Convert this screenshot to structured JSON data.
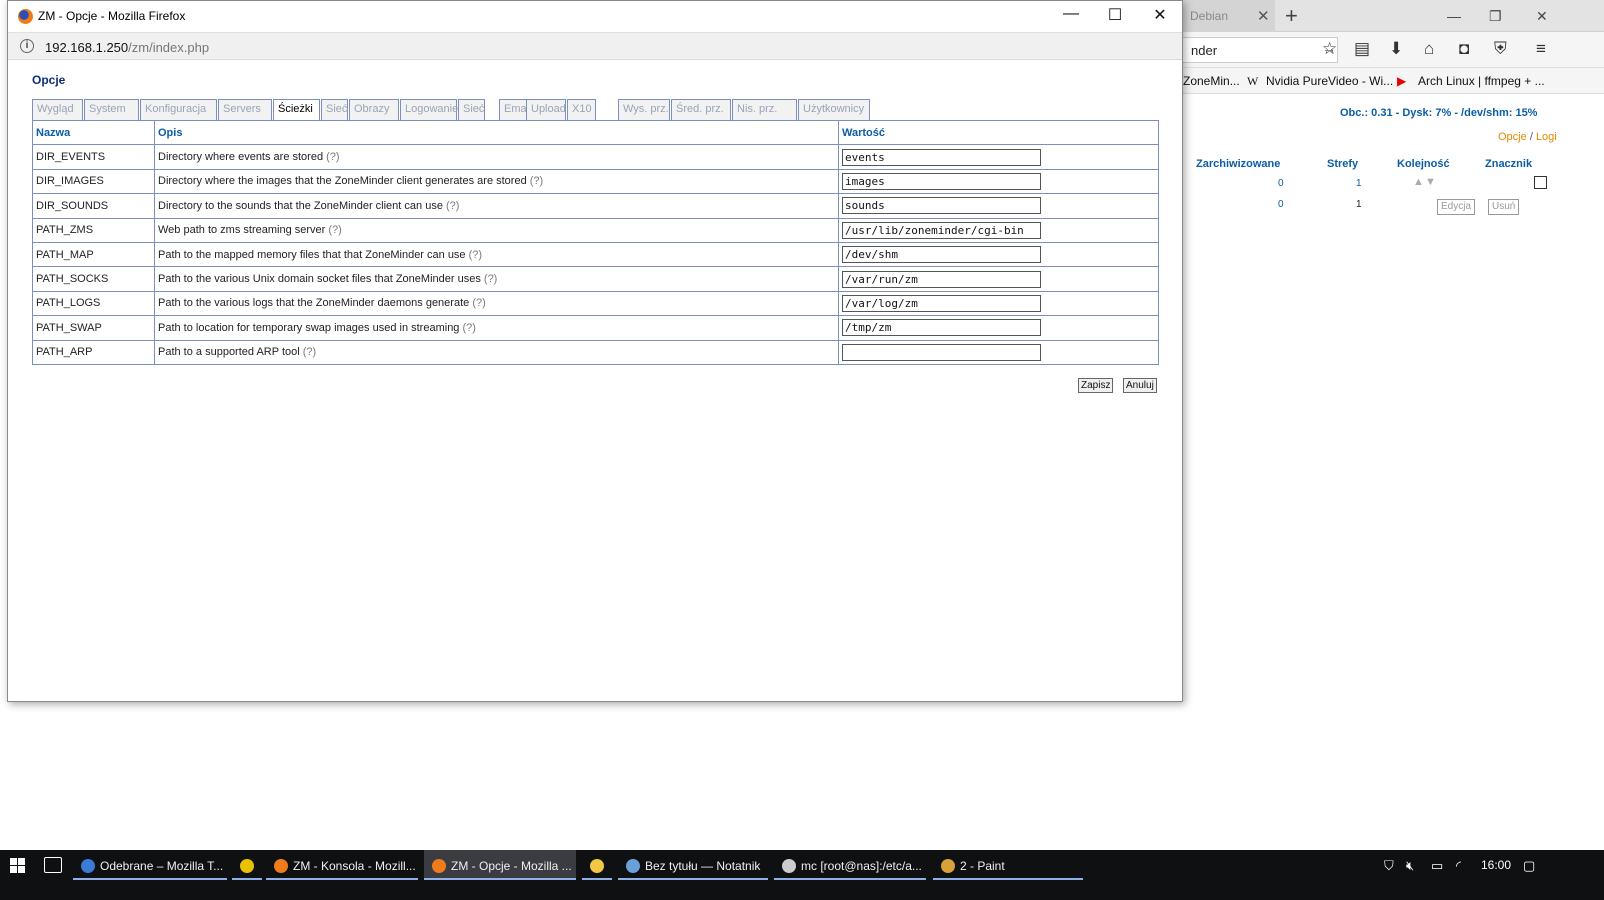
{
  "popup": {
    "title": "ZM - Opcje - Mozilla Firefox",
    "url_host": "192.168.1.250",
    "url_path": "/zm/index.php",
    "heading": "Opcje",
    "tabs": [
      {
        "label": "Wygląd",
        "active": false
      },
      {
        "label": "System",
        "active": false
      },
      {
        "label": "Konfiguracja",
        "active": false
      },
      {
        "label": "Servers",
        "active": false
      },
      {
        "label": "Ścieżki",
        "active": true
      },
      {
        "label": "Sieć",
        "active": false
      },
      {
        "label": "Obrazy",
        "active": false
      },
      {
        "label": "Logowanie",
        "active": false
      },
      {
        "label": "Sieć",
        "active": false
      },
      {
        "label": "Email",
        "active": false
      },
      {
        "label": "Upload",
        "active": false
      },
      {
        "label": "X10",
        "active": false
      },
      {
        "label": "Wys. prz.",
        "active": false
      },
      {
        "label": "Śred. prz.",
        "active": false
      },
      {
        "label": "Nis. prz.",
        "active": false
      },
      {
        "label": "Użytkownicy",
        "active": false
      }
    ],
    "table": {
      "headers": {
        "name": "Nazwa",
        "desc": "Opis",
        "value": "Wartość"
      },
      "help_marker": "(?)",
      "rows": [
        {
          "name": "DIR_EVENTS",
          "desc": "Directory where events are stored",
          "value": "events"
        },
        {
          "name": "DIR_IMAGES",
          "desc": "Directory where the images that the ZoneMinder client generates are stored",
          "value": "images"
        },
        {
          "name": "DIR_SOUNDS",
          "desc": "Directory to the sounds that the ZoneMinder client can use",
          "value": "sounds"
        },
        {
          "name": "PATH_ZMS",
          "desc": "Web path to zms streaming server",
          "value": "/usr/lib/zoneminder/cgi-bin"
        },
        {
          "name": "PATH_MAP",
          "desc": "Path to the mapped memory files that that ZoneMinder can use",
          "value": "/dev/shm"
        },
        {
          "name": "PATH_SOCKS",
          "desc": "Path to the various Unix domain socket files that ZoneMinder uses",
          "value": "/var/run/zm"
        },
        {
          "name": "PATH_LOGS",
          "desc": "Path to the various logs that the ZoneMinder daemons generate",
          "value": "/var/log/zm"
        },
        {
          "name": "PATH_SWAP",
          "desc": "Path to location for temporary swap images used in streaming",
          "value": "/tmp/zm"
        },
        {
          "name": "PATH_ARP",
          "desc": "Path to a supported ARP tool",
          "value": ""
        }
      ]
    },
    "buttons": {
      "save": "Zapisz",
      "cancel": "Anuluj"
    }
  },
  "background_window": {
    "tab_label": "Debian",
    "url_fragment": "nder",
    "bookmarks": [
      "ZoneMin...",
      "Nvidia PureVideo - Wi...",
      "Arch Linux | ffmpeg + ..."
    ],
    "bookmark_w_glyph": "W",
    "stats": "Obc.: 0.31 - Dysk: 7% - /dev/shm: 15%",
    "link_options": "Opcje",
    "link_logs": "Logi",
    "columns": [
      "Zarchiwizowane",
      "Strefy",
      "Kolejność",
      "Znacznik"
    ],
    "row1": {
      "archived": "0",
      "zones": "1"
    },
    "row2": {
      "archived": "0",
      "zones": "1",
      "edit": "Edycja",
      "delete": "Usuń"
    }
  },
  "taskbar": {
    "tasks": [
      {
        "label": "Odebrane – Mozilla T...",
        "color": "#3a7bd5"
      },
      {
        "label": "",
        "color": "#e8c200"
      },
      {
        "label": "ZM - Konsola - Mozill...",
        "color": "#f17b1b"
      },
      {
        "label": "ZM - Opcje - Mozilla ...",
        "color": "#f17b1b"
      },
      {
        "label": "",
        "color": "#f2c744"
      },
      {
        "label": "Bez tytułu — Notatnik",
        "color": "#6aa0d8"
      },
      {
        "label": "mc [root@nas]:/etc/a...",
        "color": "#cccccc"
      },
      {
        "label": "2 - Paint",
        "color": "#d9a13a"
      }
    ],
    "clock": "16:00"
  },
  "colors": {
    "link_blue": "#0b5da4",
    "heading_navy": "#0c2e7a",
    "accent_orange": "#e08a00"
  }
}
